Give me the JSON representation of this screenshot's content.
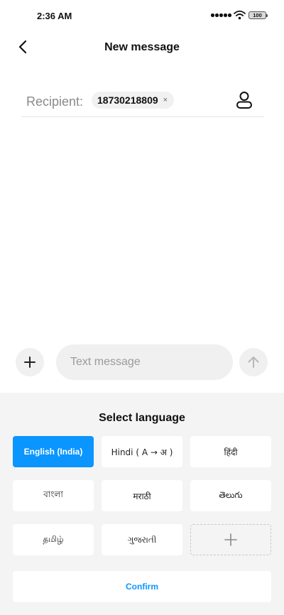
{
  "status_bar": {
    "time": "2:36 AM",
    "battery": "100",
    "icons": [
      "signal-dots-icon",
      "wifi-icon",
      "battery-icon"
    ]
  },
  "header": {
    "title": "New message",
    "back_icon": "chevron-left-icon"
  },
  "recipient": {
    "label": "Recipient:",
    "chip": "18730218809",
    "chip_close": "×",
    "contact_icon": "person-icon"
  },
  "compose": {
    "placeholder": "Text message",
    "add_icon": "plus-icon",
    "send_icon": "arrow-up-icon"
  },
  "language_sheet": {
    "title": "Select language",
    "options": [
      {
        "label": "English (India)",
        "selected": true
      },
      {
        "label": "Hindi ( A → अ )",
        "selected": false
      },
      {
        "label": "हिंदी",
        "selected": false
      },
      {
        "label": "বাংলা",
        "selected": false
      },
      {
        "label": "मराठी",
        "selected": false
      },
      {
        "label": "తెలుగు",
        "selected": false
      },
      {
        "label": "தமிழ்",
        "selected": false
      },
      {
        "label": "ગુજરાતી",
        "selected": false
      }
    ],
    "add_icon": "plus-icon",
    "confirm_label": "Confirm"
  },
  "colors": {
    "accent": "#0a95ff",
    "sheet_background": "#f4f4f4"
  }
}
